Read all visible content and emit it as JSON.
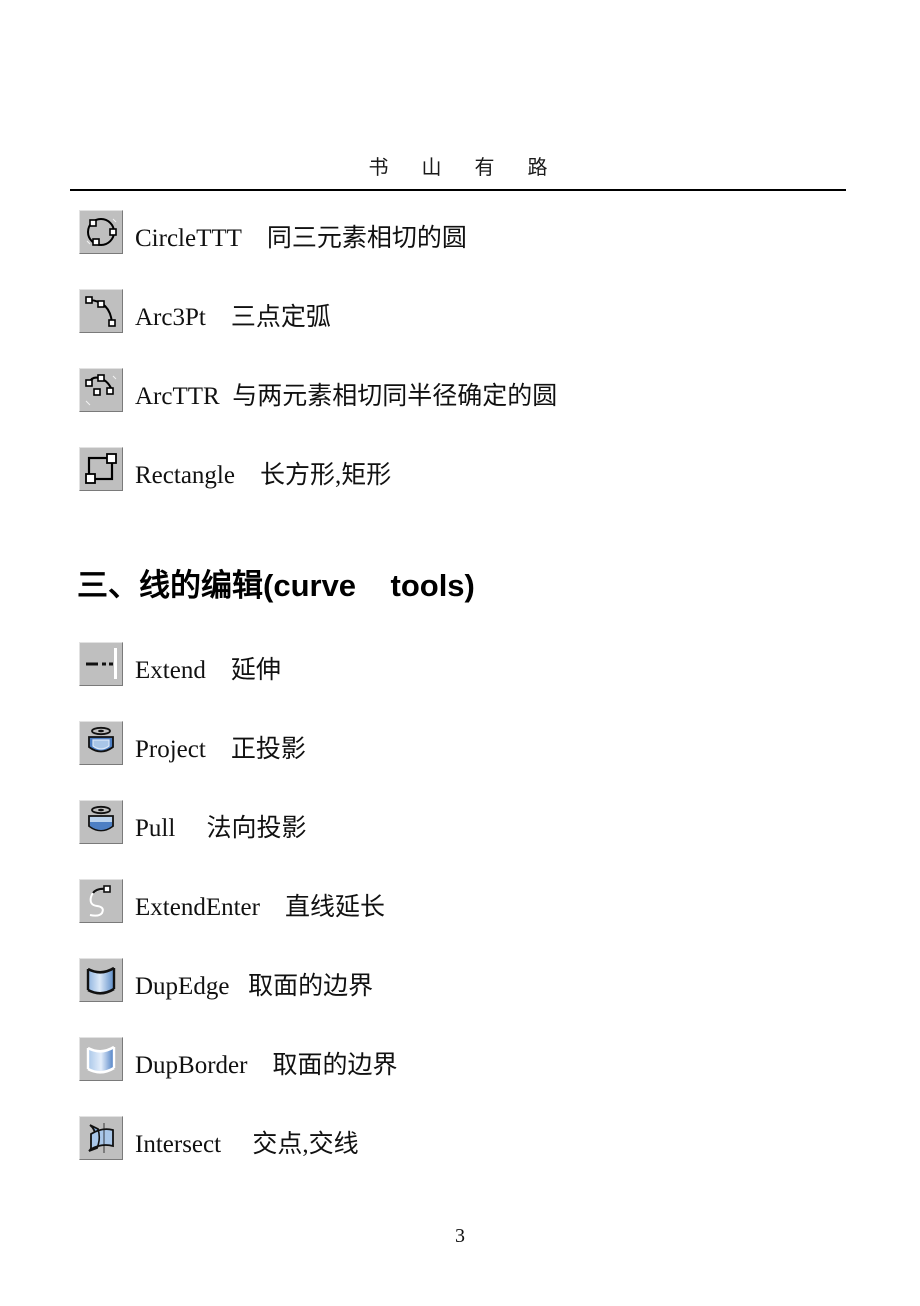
{
  "header": {
    "running_title": "书 山 有 路",
    "page_number": "3"
  },
  "section_shapes": {
    "rows": [
      {
        "icon": "circle-ttt-icon",
        "en": "CircleTTT",
        "cn": "同三元素相切的圆",
        "gap": "    "
      },
      {
        "icon": "arc-3pt-icon",
        "en": "Arc3Pt",
        "cn": "三点定弧",
        "gap": "    "
      },
      {
        "icon": "arc-ttr-icon",
        "en": "ArcTTR",
        "cn": "与两元素相切同半径确定的圆",
        "gap": "  "
      },
      {
        "icon": "rectangle-icon",
        "en": "Rectangle",
        "cn": "长方形,矩形",
        "gap": "    "
      }
    ]
  },
  "section_curve_tools": {
    "heading": "三、线的编辑(curve    tools)",
    "rows": [
      {
        "icon": "extend-icon",
        "en": "Extend",
        "cn": "延伸",
        "gap": "    "
      },
      {
        "icon": "project-icon",
        "en": "Project",
        "cn": "正投影",
        "gap": "    "
      },
      {
        "icon": "pull-icon",
        "en": "Pull",
        "cn": "法向投影",
        "gap": "     "
      },
      {
        "icon": "extend-enter-icon",
        "en": "ExtendEnter",
        "cn": "直线延长",
        "gap": "    "
      },
      {
        "icon": "dup-edge-icon",
        "en": "DupEdge",
        "cn": "取面的边界",
        "gap": "   "
      },
      {
        "icon": "dup-border-icon",
        "en": "DupBorder",
        "cn": "取面的边界",
        "gap": "    "
      },
      {
        "icon": "intersect-icon",
        "en": "Intersect",
        "cn": "交点,交线",
        "gap": "     "
      }
    ]
  },
  "colors": {
    "icon_face": "#bfbfbf",
    "icon_blue_light": "#bcd2ee",
    "icon_blue": "#5f8fd0",
    "icon_blue_dark": "#2e5c96",
    "text": "#111111"
  }
}
